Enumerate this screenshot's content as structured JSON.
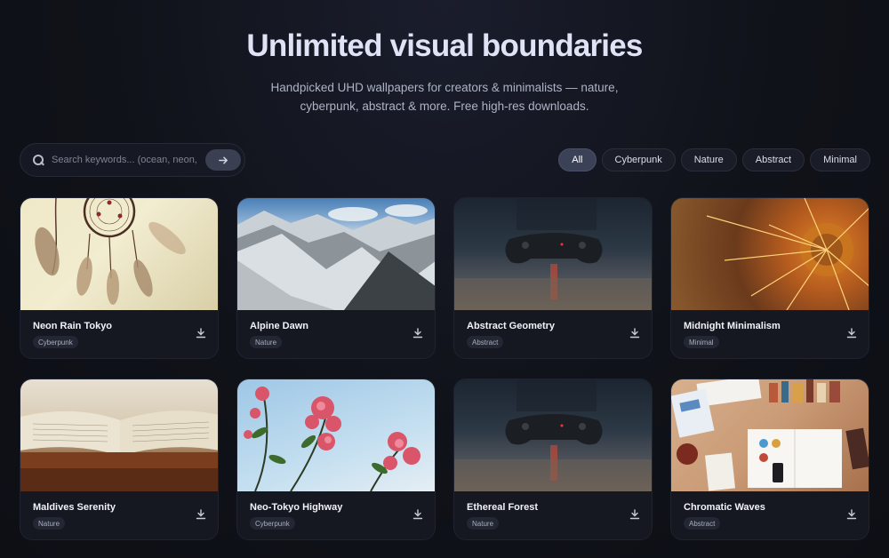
{
  "hero": {
    "title": "Unlimited visual boundaries",
    "subtitle": "Handpicked UHD wallpapers for creators & minimalists — nature, cyberpunk, abstract & more. Free high-res downloads."
  },
  "search": {
    "placeholder": "Search keywords... (ocean, neon, r",
    "submit_icon": "arrow-right-icon"
  },
  "filters": [
    "All",
    "Cyberpunk",
    "Nature",
    "Abstract",
    "Minimal"
  ],
  "active_filter": "All",
  "cards": [
    {
      "title": "Neon Rain Tokyo",
      "tag": "Cyberpunk",
      "image": "dreamcatcher"
    },
    {
      "title": "Alpine Dawn",
      "tag": "Nature",
      "image": "snowy-mountains"
    },
    {
      "title": "Abstract Geometry",
      "tag": "Abstract",
      "image": "game-controller"
    },
    {
      "title": "Midnight Minimalism",
      "tag": "Minimal",
      "image": "cactus-spines"
    },
    {
      "title": "Maldives Serenity",
      "tag": "Nature",
      "image": "open-book"
    },
    {
      "title": "Neo-Tokyo Highway",
      "tag": "Cyberpunk",
      "image": "pink-flowers"
    },
    {
      "title": "Ethereal Forest",
      "tag": "Nature",
      "image": "game-controller"
    },
    {
      "title": "Chromatic Waves",
      "tag": "Abstract",
      "image": "designer-desk"
    }
  ],
  "colors": {
    "background": "#101219",
    "card": "#151821",
    "chip_active": "#3b4157"
  }
}
